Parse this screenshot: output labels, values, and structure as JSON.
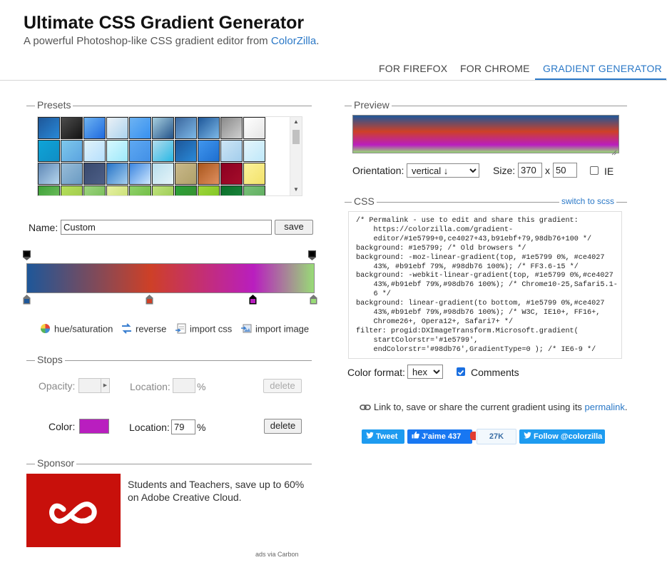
{
  "header": {
    "title": "Ultimate CSS Gradient Generator",
    "subtitle_prefix": "A powerful Photoshop-like CSS gradient editor from ",
    "subtitle_link": "ColorZilla",
    "subtitle_suffix": "."
  },
  "nav": {
    "tabs": [
      {
        "label": "FOR FIREFOX"
      },
      {
        "label": "FOR CHROME"
      },
      {
        "label": "GRADIENT GENERATOR",
        "active": true
      }
    ]
  },
  "presets": {
    "section_label": "Presets",
    "swatches": [
      [
        "#1e5799",
        "#2989d8"
      ],
      [
        "#4c4c4c",
        "#131313"
      ],
      [
        "#6db3f2",
        "#1e69de"
      ],
      [
        "#ebf1f6",
        "#abd3ee"
      ],
      [
        "#6db3f2",
        "#3690f0"
      ],
      [
        "#a7cfdf",
        "#23538a"
      ],
      [
        "#3b679e",
        "#7db9e8"
      ],
      [
        "#1e5799",
        "#7db9e8"
      ],
      [
        "#8a8a8a",
        "#d0d0d0"
      ],
      [
        "#ffffff",
        "#e5e5e5"
      ],
      [
        "#0ea4d7",
        "#108ec5"
      ],
      [
        "#7ec8ec",
        "#5ba4e0"
      ],
      [
        "#e0f3fa",
        "#b6dffd"
      ],
      [
        "#d6f9ff",
        "#9ee8fa"
      ],
      [
        "#5ea8f2",
        "#4290e6"
      ],
      [
        "#b3dced",
        "#29b8e5"
      ],
      [
        "#1e5799",
        "#2989d8"
      ],
      [
        "#4096ee",
        "#1e6fd0"
      ],
      [
        "#cde5f5",
        "#a2cdec"
      ],
      [
        "#e4f5fc",
        "#bfe8f9"
      ],
      [
        "#5e87b5",
        "#b6d6ee"
      ],
      [
        "#98bcd8",
        "#6a9bc3"
      ],
      [
        "#38496e",
        "#4d5f87"
      ],
      [
        "#2573c7",
        "#a6cfef"
      ],
      [
        "#3a84df",
        "#cfe8ff"
      ],
      [
        "#b7deed",
        "#e6f4f9"
      ],
      [
        "#c9b88a",
        "#b0a16a"
      ],
      [
        "#a9561c",
        "#e09060"
      ],
      [
        "#8c0020",
        "#a50d2b"
      ],
      [
        "#fcf29b",
        "#f2e26a"
      ],
      [
        "#3fa23a",
        "#77c263"
      ],
      [
        "#b4df5b",
        "#9ec64a"
      ],
      [
        "#9dd47f",
        "#6fb850"
      ],
      [
        "#e6f0a3",
        "#c4dd6a"
      ],
      [
        "#8fd16a",
        "#6ab83b"
      ],
      [
        "#bfe27d",
        "#94c64a"
      ],
      [
        "#2aa23a",
        "#3c8b2e"
      ],
      [
        "#9dd53a",
        "#7bc21f"
      ],
      [
        "#0b6e2a",
        "#1c8a3f"
      ],
      [
        "#78c078",
        "#5aa95a"
      ]
    ]
  },
  "name_row": {
    "label": "Name:",
    "value": "Custom",
    "save_label": "save"
  },
  "gradient": {
    "stops": [
      {
        "color": "#1e5799",
        "location": 0
      },
      {
        "color": "#ce4027",
        "location": 43
      },
      {
        "color": "#b91ebf",
        "location": 79
      },
      {
        "color": "#98db76",
        "location": 100
      }
    ],
    "opacity_stops": [
      0,
      100
    ],
    "selected_stop": 2
  },
  "tools": {
    "hue_saturation": "hue/saturation",
    "reverse": "reverse",
    "import_css": "import css",
    "import_image": "import image"
  },
  "stops_panel": {
    "section_label": "Stops",
    "opacity_label": "Opacity:",
    "location_label": "Location:",
    "percent": "%",
    "delete_label": "delete",
    "color_label": "Color:",
    "color_value": "#b91ebf",
    "color_location": "79"
  },
  "sponsor": {
    "section_label": "Sponsor",
    "text_line1": "Students and Teachers, save up to 60%",
    "text_line2": "on Adobe Creative Cloud.",
    "footer": "ads via Carbon"
  },
  "preview": {
    "section_label": "Preview",
    "orientation_label": "Orientation:",
    "orientation_value": "vertical ↓",
    "size_label": "Size:",
    "width": "370",
    "x_label": "x",
    "height": "50",
    "ie_label": "IE"
  },
  "css_panel": {
    "section_label": "CSS",
    "switch_label": "switch to scss",
    "code": "/* Permalink - use to edit and share this gradient:\n    https://colorzilla.com/gradient-\n    editor/#1e5799+0,ce4027+43,b91ebf+79,98db76+100 */\nbackground: #1e5799; /* Old browsers */\nbackground: -moz-linear-gradient(top, #1e5799 0%, #ce4027\n    43%, #b91ebf 79%, #98db76 100%); /* FF3.6-15 */\nbackground: -webkit-linear-gradient(top, #1e5799 0%,#ce4027\n    43%,#b91ebf 79%,#98db76 100%); /* Chrome10-25,Safari5.1-\n    6 */\nbackground: linear-gradient(to bottom, #1e5799 0%,#ce4027\n    43%,#b91ebf 79%,#98db76 100%); /* W3C, IE10+, FF16+,\n    Chrome26+, Opera12+, Safari7+ */\nfilter: progid:DXImageTransform.Microsoft.gradient(\n    startColorstr='#1e5799',\n    endColorstr='#98db76',GradientType=0 ); /* IE6-9 */",
    "format_label": "Color format:",
    "format_value": "hex",
    "comments_label": "Comments",
    "comments_checked": true
  },
  "permalink": {
    "text": "Link to, save or share the current gradient using its ",
    "link": "permalink",
    "suffix": "."
  },
  "social": {
    "tweet": "Tweet",
    "like": "J'aime 437",
    "count": "27K",
    "follow": "Follow @colorzilla"
  },
  "colors": {
    "accent": "#2a78c7",
    "twitter": "#1d9bf0",
    "facebook": "#1877f2",
    "sponsor_red": "#c8100b"
  },
  "icons": [
    "hue-saturation-icon",
    "reverse-icon",
    "import-css-icon",
    "import-image-icon",
    "link-icon",
    "twitter-bird-icon",
    "thumbs-up-icon",
    "adobe-cc-logo"
  ]
}
